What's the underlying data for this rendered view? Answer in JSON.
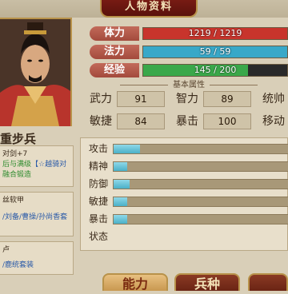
{
  "title": "人物资料",
  "unit_name": "重步兵",
  "stats": [
    {
      "label": "体力",
      "value": "1219 / 1219",
      "fraction": 1.0,
      "color": "#c8342c"
    },
    {
      "label": "法力",
      "value": "59 / 59",
      "fraction": 1.0,
      "color": "#38a8c8"
    },
    {
      "label": "经验",
      "value": "145 / 200",
      "fraction": 0.725,
      "color": "#3aa84a"
    }
  ],
  "section_title": "基本属性",
  "attributes": [
    {
      "label": "武力",
      "value": "91"
    },
    {
      "label": "智力",
      "value": "89"
    },
    {
      "label": "统帅",
      "value": ""
    },
    {
      "label": "敏捷",
      "value": "84"
    },
    {
      "label": "暴击",
      "value": "100"
    },
    {
      "label": "移动",
      "value": ""
    }
  ],
  "side_panels": {
    "p1_line1": "对剑+7",
    "p1_line2a": "后与满级",
    "p1_line2b": "【☆越骑对",
    "p1_line3": "融合锻造",
    "p2_line1": "丝软甲",
    "p2_line2": "/刘备/曹操/孙尚香套",
    "p3_line1": "卢",
    "p3_line2": "/鹿统套装"
  },
  "skills": [
    {
      "label": "攻击",
      "fraction": 0.15
    },
    {
      "label": "精神",
      "fraction": 0.08
    },
    {
      "label": "防御",
      "fraction": 0.09
    },
    {
      "label": "敏捷",
      "fraction": 0.08
    },
    {
      "label": "暴击",
      "fraction": 0.08
    },
    {
      "label": "状态",
      "fraction": null
    }
  ],
  "tabs": [
    {
      "label": "能力",
      "active": true
    },
    {
      "label": "兵种",
      "active": false
    },
    {
      "label": "",
      "active": false
    }
  ]
}
